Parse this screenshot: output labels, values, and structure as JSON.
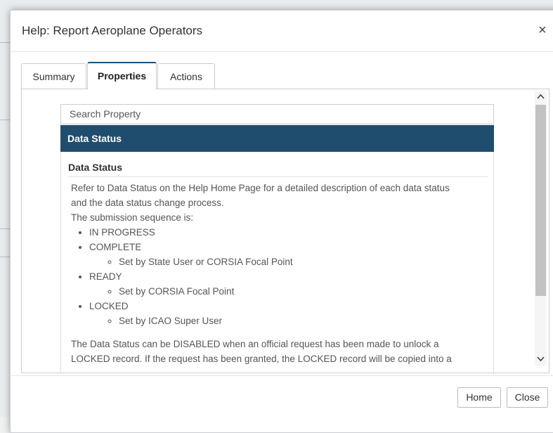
{
  "dialog": {
    "title": "Help: Report Aeroplane Operators",
    "close_symbol": "×"
  },
  "tabs": [
    {
      "label": "Summary",
      "active": false
    },
    {
      "label": "Properties",
      "active": true
    },
    {
      "label": "Actions",
      "active": false
    }
  ],
  "search": {
    "placeholder": "Search Property"
  },
  "selected_property": "Data Status",
  "panel": {
    "title": "Data Status",
    "intro_line1": "Refer to Data Status on the Help Home Page for a detailed description of each data status",
    "intro_line2": "and the data status change process.",
    "sequence_label": "The submission sequence is:",
    "items": [
      {
        "label": "IN PROGRESS",
        "sub": null
      },
      {
        "label": "COMPLETE",
        "sub": "Set by State User or CORSIA Focal Point"
      },
      {
        "label": "READY",
        "sub": "Set by CORSIA Focal Point"
      },
      {
        "label": "LOCKED",
        "sub": "Set by ICAO Super User"
      }
    ],
    "outro_line1": "The Data Status can be DISABLED when an official request has been made to unlock a",
    "outro_line2": "LOCKED record. If the request has been granted, the LOCKED record will be copied into a"
  },
  "footer": {
    "home_label": "Home",
    "close_label": "Close"
  },
  "colors": {
    "selected_bar": "#1f4d6e",
    "active_tab_border": "#1e4f70"
  },
  "icons": {
    "scroll_up": "chevron-up-icon",
    "scroll_down": "chevron-down-icon",
    "close": "close-icon"
  }
}
